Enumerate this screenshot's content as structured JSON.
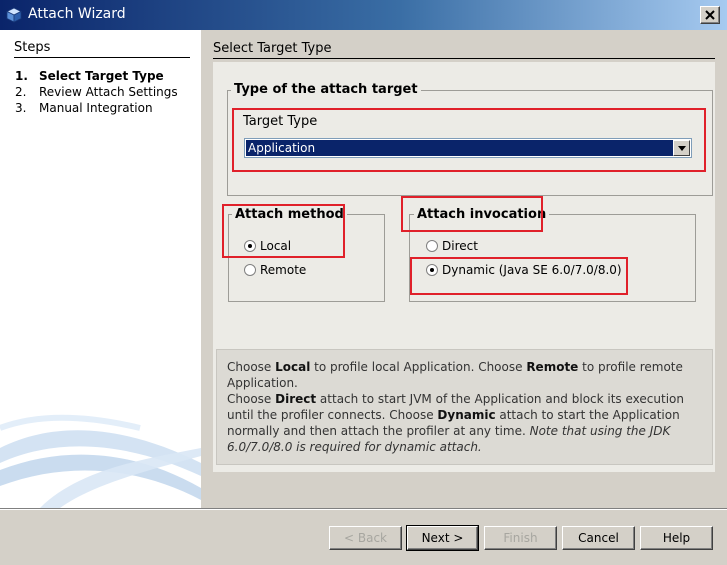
{
  "window": {
    "title": "Attach Wizard"
  },
  "steps": {
    "heading": "Steps",
    "items": [
      {
        "num": "1.",
        "label": "Select Target Type",
        "active": true
      },
      {
        "num": "2.",
        "label": "Review Attach Settings",
        "active": false
      },
      {
        "num": "3.",
        "label": "Manual Integration",
        "active": false
      }
    ]
  },
  "page": {
    "title": "Select Target Type"
  },
  "target_group": {
    "label": "Type of the attach target",
    "field_label": "Target Type",
    "selected_value": "Application"
  },
  "method_group": {
    "label": "Attach method",
    "options": [
      {
        "label": "Local",
        "checked": true
      },
      {
        "label": "Remote",
        "checked": false
      }
    ]
  },
  "invocation_group": {
    "label": "Attach invocation",
    "options": [
      {
        "label": "Direct",
        "checked": false
      },
      {
        "label": "Dynamic (Java SE 6.0/7.0/8.0)",
        "checked": true
      }
    ]
  },
  "info": {
    "p1_a": "Choose ",
    "p1_b": "Local",
    "p1_c": " to profile local Application. Choose ",
    "p1_d": "Remote",
    "p1_e": " to profile remote Application.",
    "p2_a": "Choose ",
    "p2_b": "Direct",
    "p2_c": " attach to start JVM of the Application and block its execution until the profiler connects. Choose ",
    "p2_d": "Dynamic",
    "p2_e": " attach to start the Application normally and then attach the profiler at any time. ",
    "p2_note": "Note that using the JDK 6.0/7.0/8.0 is required for dynamic attach."
  },
  "buttons": {
    "back": "< Back",
    "next": "Next >",
    "finish": "Finish",
    "cancel": "Cancel",
    "help": "Help"
  },
  "colors": {
    "titlebar": "#0a246a",
    "selection": "#0a246a",
    "highlight": "#e0202a",
    "dialog_bg": "#d4d0c8"
  }
}
